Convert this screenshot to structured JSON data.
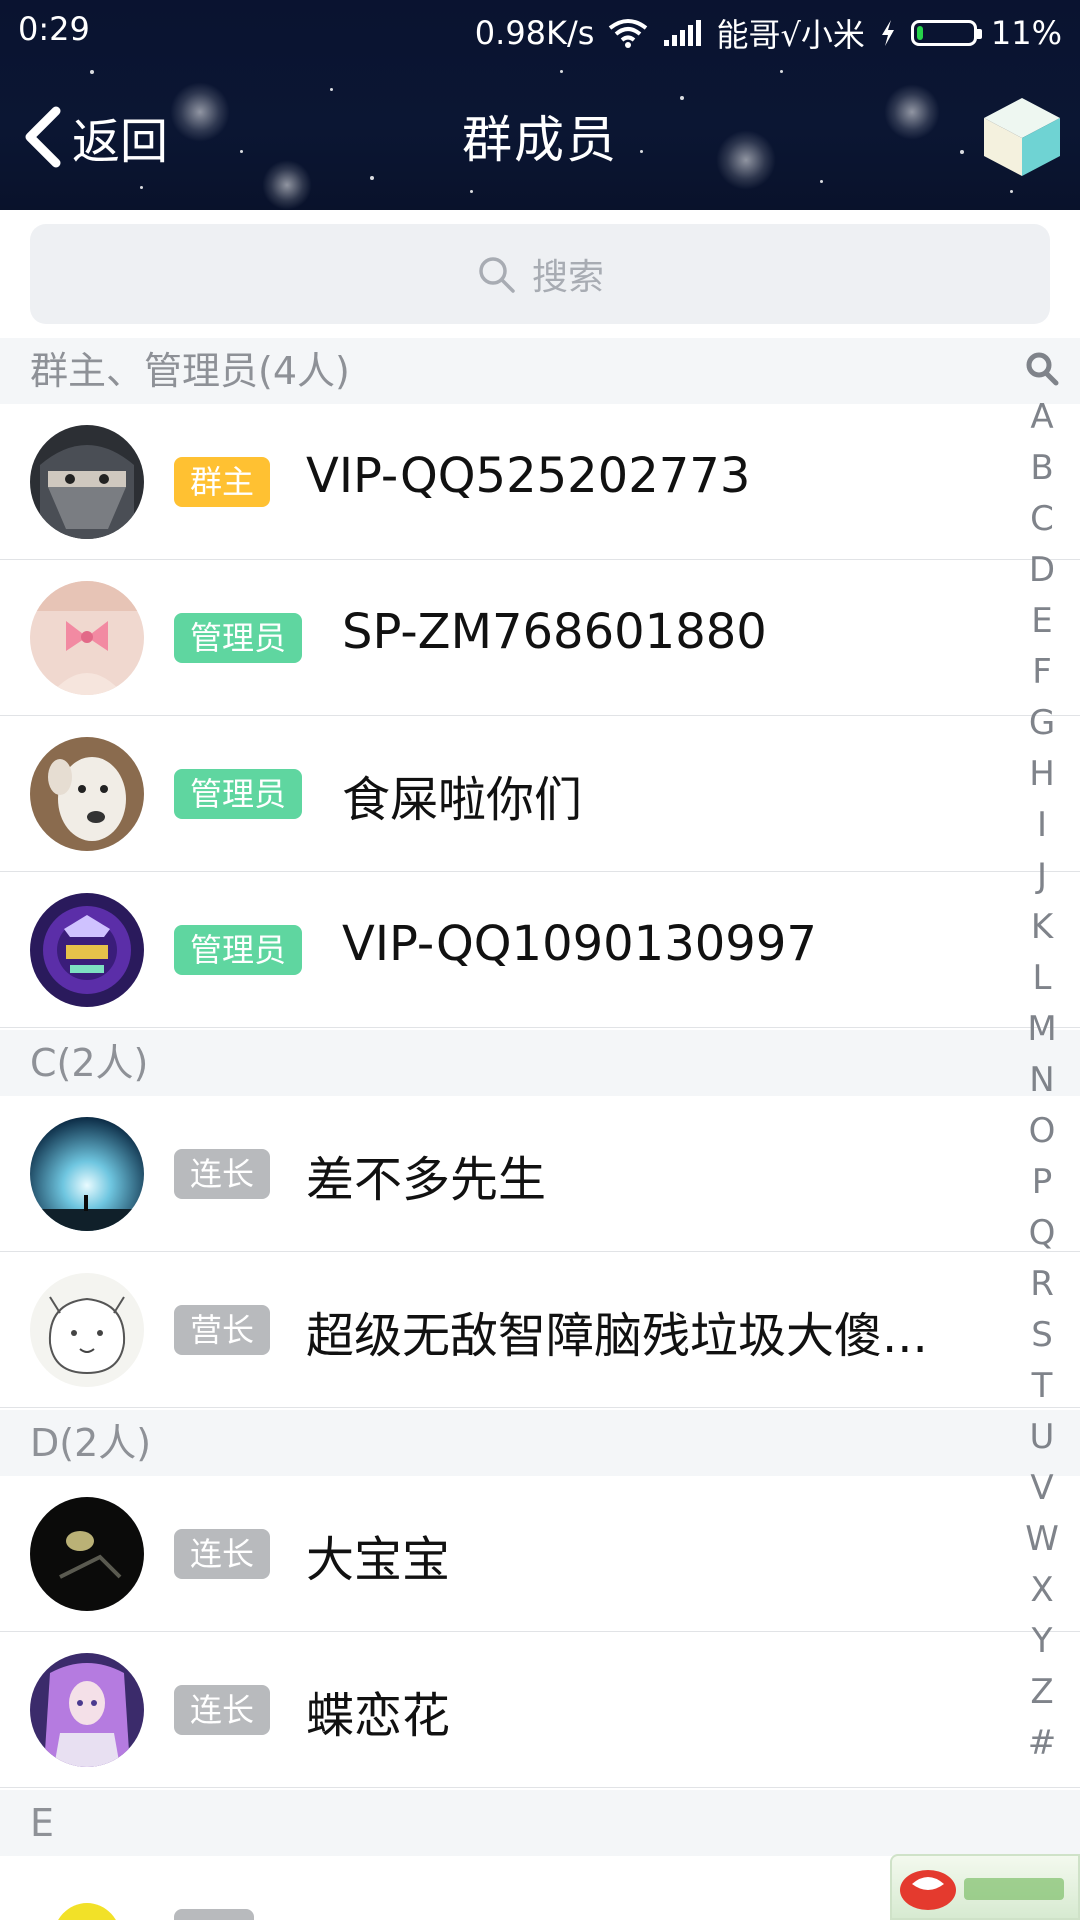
{
  "status_bar": {
    "time": "0:29",
    "speed": "0.98K/s",
    "carrier": "能哥√小米",
    "battery": "11%",
    "battery_level": 0.11
  },
  "nav": {
    "back_label": "返回",
    "title": "群成员"
  },
  "search": {
    "placeholder": "搜索"
  },
  "sections": {
    "admins": "群主、管理员(4人)",
    "c": "C(2人)",
    "d": "D(2人)",
    "e": "E"
  },
  "members": [
    {
      "badge": "群主",
      "badge_color": "#ffc132",
      "name": "VIP-QQ525202773"
    },
    {
      "badge": "管理员",
      "badge_color": "#5fd6a0",
      "name": "SP-ZM768601880"
    },
    {
      "badge": "管理员",
      "badge_color": "#5fd6a0",
      "name": "食屎啦你们"
    },
    {
      "badge": "管理员",
      "badge_color": "#5fd6a0",
      "name": "VIP-QQ1090130997"
    },
    {
      "badge": "连长",
      "badge_color": "#b8babd",
      "name": "差不多先生"
    },
    {
      "badge": "营长",
      "badge_color": "#b8babd",
      "name": "超级无敌智障脑残垃圾大傻..."
    },
    {
      "badge": "连长",
      "badge_color": "#b8babd",
      "name": "大宝宝"
    },
    {
      "badge": "连长",
      "badge_color": "#b8babd",
      "name": "蝶恋花"
    }
  ],
  "index_letters": [
    "A",
    "B",
    "C",
    "D",
    "E",
    "F",
    "G",
    "H",
    "I",
    "J",
    "K",
    "L",
    "M",
    "N",
    "O",
    "P",
    "Q",
    "R",
    "S",
    "T",
    "U",
    "V",
    "W",
    "X",
    "Y",
    "Z",
    "#"
  ],
  "icons": {
    "back": "chevron-left-icon",
    "search": "search-icon",
    "menu": "cube-icon",
    "index_search": "search-icon"
  }
}
